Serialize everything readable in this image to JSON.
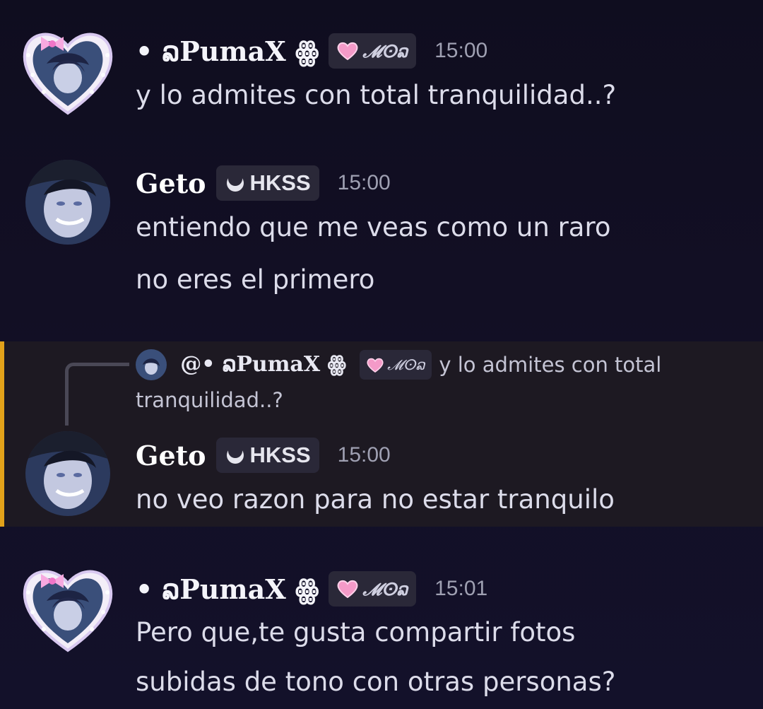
{
  "messages": [
    {
      "user": "• ລPumaX ꙮ",
      "tag": "𝓜ⵙລ",
      "time": "15:00",
      "lines": [
        "y lo admites con total tranquilidad..?"
      ]
    },
    {
      "user": "Geto",
      "tag": "HKSS",
      "time": "15:00",
      "lines": [
        "entiendo que me veas como un raro",
        "no eres el primero"
      ]
    },
    {
      "user": "Geto",
      "tag": "HKSS",
      "time": "15:00",
      "lines": [
        "no veo razon para no estar tranquilo"
      ],
      "reply": {
        "user": "@• ລPumaX ꙮ",
        "tag": "𝓜ⵙລ",
        "text": "y lo admites con total tranquilidad..?"
      }
    },
    {
      "user": "• ລPumaX ꙮ",
      "tag": "𝓜ⵙລ",
      "time": "15:01",
      "lines": [
        "Pero que,te gusta compartir fotos",
        "subidas de tono con otras personas?"
      ]
    }
  ],
  "colors": {
    "background": "#110f22",
    "highlight": "#1d1922",
    "highlight_bar": "#e2a21a",
    "tag_bg": "#2a2838",
    "timestamp": "#9fa0b2"
  },
  "icons": {
    "pumax_tag": "pink-heart-icon",
    "geto_tag": "crescent-moon-icon"
  }
}
